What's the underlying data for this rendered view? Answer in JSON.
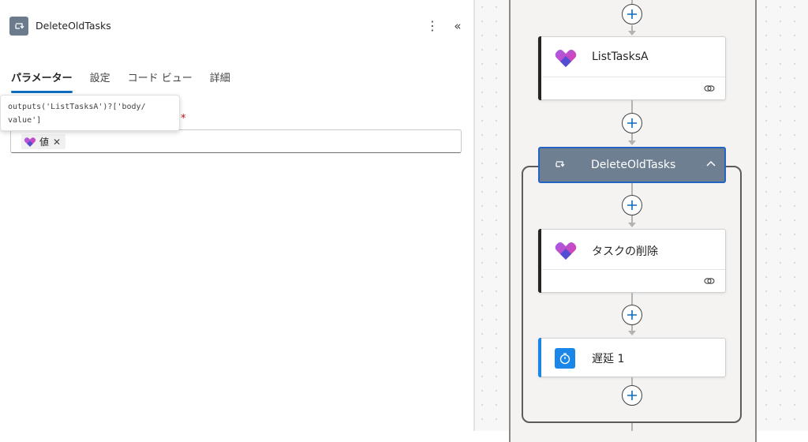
{
  "panel": {
    "title": "DeleteOldTasks",
    "more_label": "⋮",
    "collapse_label": "«",
    "tabs": [
      {
        "label": "パラメーター",
        "active": true
      },
      {
        "label": "設定",
        "active": false
      },
      {
        "label": "コード ビュー",
        "active": false
      },
      {
        "label": "詳細",
        "active": false
      }
    ],
    "tooltip_text": "outputs('ListTasksA')?['body/\nvalue']",
    "required_mark": "*",
    "token": {
      "label": "値",
      "remove": "✕"
    }
  },
  "canvas": {
    "nodes": [
      {
        "id": "list-tasks-a",
        "label": "ListTasksA",
        "icon": "planner-icon",
        "has_link": true
      },
      {
        "id": "scope",
        "label": "DeleteOldTasks",
        "icon": "loop-icon",
        "collapse_icon": "chevron-up-icon"
      },
      {
        "id": "delete-task",
        "label": "タスクの削除",
        "icon": "planner-icon",
        "has_link": true
      },
      {
        "id": "delay-1",
        "label": "遅延 1",
        "icon": "timer-icon"
      }
    ]
  },
  "colors": {
    "accent": "#0f6cbd",
    "scope_header": "#6e7f91",
    "scope_selected_border": "#2263c4",
    "card_accent_dark": "#242424",
    "card_accent_blue": "#1a86e8",
    "required": "#c50f1f"
  }
}
